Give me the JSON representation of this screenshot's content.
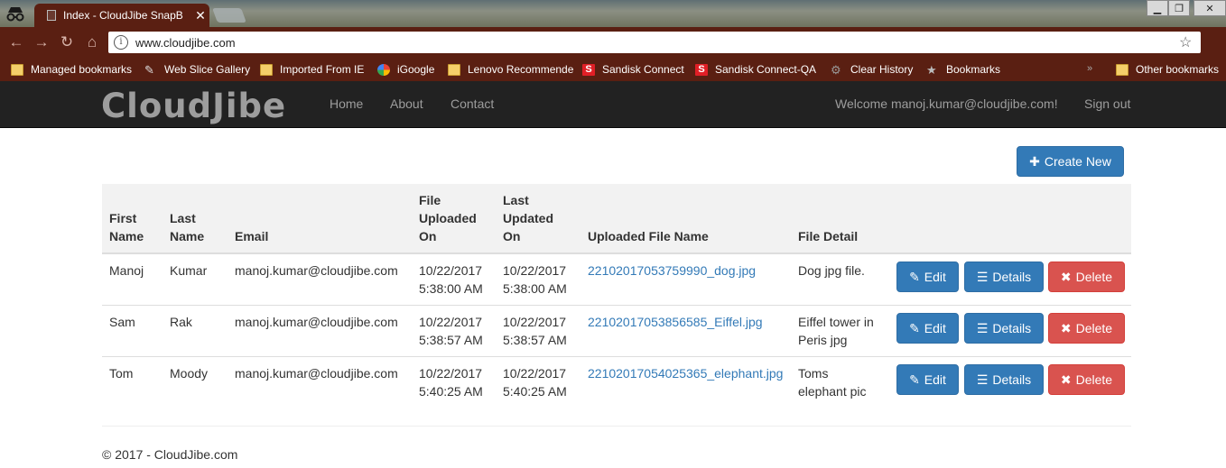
{
  "browser": {
    "tab_title": "Index - CloudJibe SnapB",
    "tab_close": "✕",
    "url": "www.cloudjibe.com",
    "bookmarks": [
      {
        "label": "Managed bookmarks",
        "icon": "folder-icon"
      },
      {
        "label": "Web Slice Gallery",
        "icon": "web-slice-icon"
      },
      {
        "label": "Imported From IE",
        "icon": "folder-icon"
      },
      {
        "label": "iGoogle",
        "icon": "google-icon"
      },
      {
        "label": "Lenovo Recommende",
        "icon": "folder-icon"
      },
      {
        "label": "Sandisk Connect",
        "icon": "sandisk-icon"
      },
      {
        "label": "Sandisk Connect-QA",
        "icon": "sandisk-icon"
      },
      {
        "label": "Clear History",
        "icon": "gear-icon"
      },
      {
        "label": "Bookmarks",
        "icon": "star-icon"
      }
    ],
    "overflow": "»",
    "other_bookmarks": "Other bookmarks"
  },
  "site": {
    "brand": "CloudJibe",
    "nav": {
      "home": "Home",
      "about": "About",
      "contact": "Contact"
    },
    "welcome": "Welcome manoj.kumar@cloudjibe.com!",
    "signout": "Sign out"
  },
  "page": {
    "create_new": "Create New",
    "columns": {
      "first_name": [
        "First",
        "Name"
      ],
      "last_name": [
        "Last",
        "Name"
      ],
      "email": "Email",
      "uploaded_on": [
        "File",
        "Uploaded",
        "On"
      ],
      "updated_on": [
        "Last",
        "Updated",
        "On"
      ],
      "file_name": "Uploaded File Name",
      "file_detail": "File Detail"
    },
    "rows": [
      {
        "first": "Manoj",
        "last": "Kumar",
        "email": "manoj.kumar@cloudjibe.com",
        "uploaded_date": "10/22/2017",
        "uploaded_time": "5:38:00 AM",
        "updated_date": "10/22/2017",
        "updated_time": "5:38:00 AM",
        "file": "22102017053759990_dog.jpg",
        "detail": "Dog jpg file."
      },
      {
        "first": "Sam",
        "last": "Rak",
        "email": "manoj.kumar@cloudjibe.com",
        "uploaded_date": "10/22/2017",
        "uploaded_time": "5:38:57 AM",
        "updated_date": "10/22/2017",
        "updated_time": "5:38:57 AM",
        "file": "22102017053856585_Eiffel.jpg",
        "detail": "Eiffel tower in Peris jpg"
      },
      {
        "first": "Tom",
        "last": "Moody",
        "email": "manoj.kumar@cloudjibe.com",
        "uploaded_date": "10/22/2017",
        "uploaded_time": "5:40:25 AM",
        "updated_date": "10/22/2017",
        "updated_time": "5:40:25 AM",
        "file": "22102017054025365_elephant.jpg",
        "detail": "Toms elephant pic"
      }
    ],
    "actions": {
      "edit": "Edit",
      "details": "Details",
      "delete": "Delete"
    },
    "footer": "© 2017 - CloudJibe.com"
  },
  "colors": {
    "primary": "#337ab7",
    "danger": "#d9534f",
    "navbar": "#222222",
    "chrome": "#5a1f12"
  }
}
